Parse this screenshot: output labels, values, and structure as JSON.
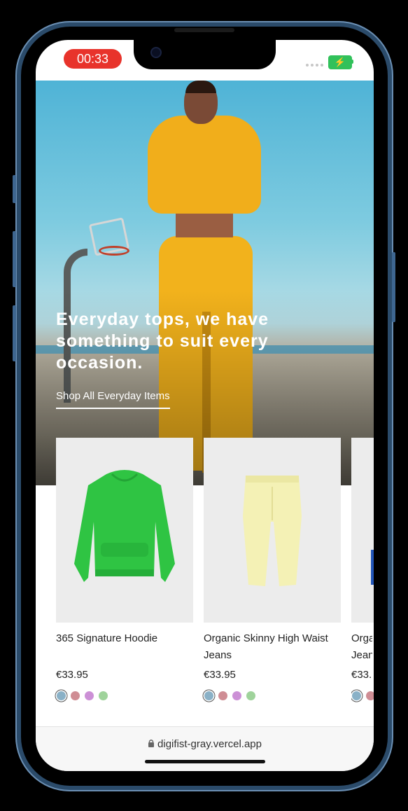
{
  "status_bar": {
    "recording_time": "00:33",
    "battery_glyph": "⚡"
  },
  "hero": {
    "title": "Everyday tops, we have something to suit every occasion.",
    "link_label": "Shop All Everyday Items"
  },
  "products": [
    {
      "name": "365 Signature Hoodie",
      "price": "€33.95",
      "swatches": [
        "#8ab1c7",
        "#cf8d94",
        "#cc90d6",
        "#9fd39b"
      ]
    },
    {
      "name": "Organic Skinny High Waist Jeans",
      "price": "€33.95",
      "swatches": [
        "#8ab1c7",
        "#cf8d94",
        "#cc90d6",
        "#9fd39b"
      ]
    },
    {
      "name": "Orga Jean",
      "price": "€33.",
      "swatches": [
        "#8ab1c7",
        "#cf8d94"
      ]
    }
  ],
  "browser": {
    "lock_icon": "lock-icon",
    "url": "digifist-gray.vercel.app"
  },
  "colors": {
    "frame": "#2b4b6a",
    "recording": "#e8332b",
    "battery": "#31c15a",
    "hoodie": "#2fc443",
    "pants": "#f4f1b5"
  }
}
